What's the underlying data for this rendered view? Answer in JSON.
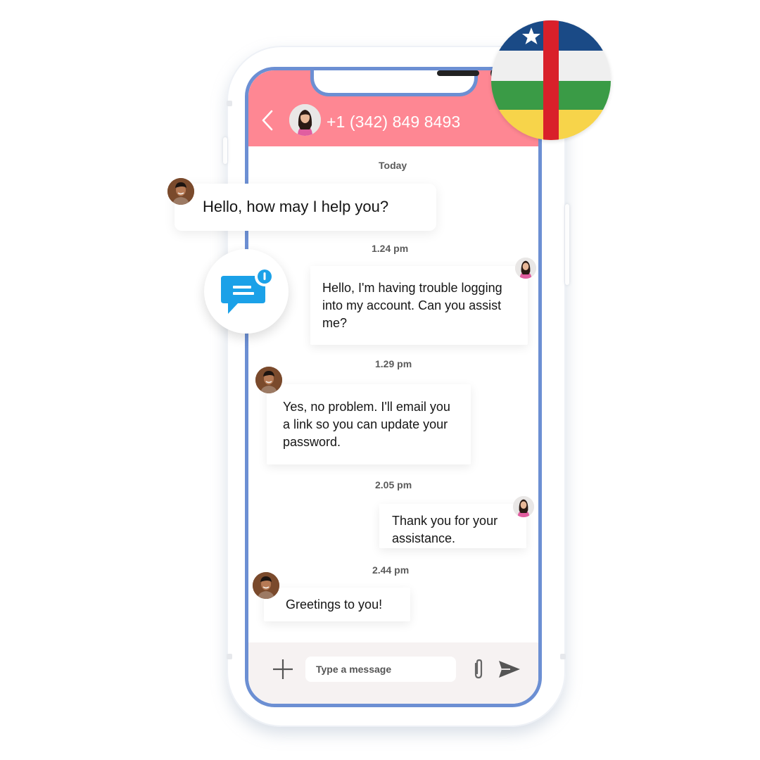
{
  "header": {
    "contact_number": "+1 (342) 849 8493",
    "background_color": "#fe8793",
    "back_icon": "chevron-left-icon"
  },
  "floating": {
    "greeting_message": "Hello, how may I help you?",
    "chat_notification_icon": "chat-bubble-alert-icon",
    "flag_icon": "central-african-republic-flag-icon",
    "accent_color": "#1ba1e8"
  },
  "chat": {
    "date_label": "Today",
    "messages": [
      {
        "time": "1.24 pm",
        "sender": "customer",
        "text": "Hello, I'm having trouble logging into my account. Can you assist me?"
      },
      {
        "time": "1.29 pm",
        "sender": "agent",
        "text": "Yes, no problem. I'll email you a link so you can update your password."
      },
      {
        "time": "2.05 pm",
        "sender": "customer",
        "text": "Thank you for your assistance."
      },
      {
        "time": "2.44 pm",
        "sender": "agent",
        "text": "Greetings to you!"
      }
    ]
  },
  "composer": {
    "placeholder": "Type a message",
    "value": "",
    "add_icon": "plus-icon",
    "attach_icon": "paperclip-icon",
    "send_icon": "send-icon"
  },
  "colors": {
    "screen_border": "#6c8fd3",
    "composer_bg": "#f6f2f2"
  }
}
